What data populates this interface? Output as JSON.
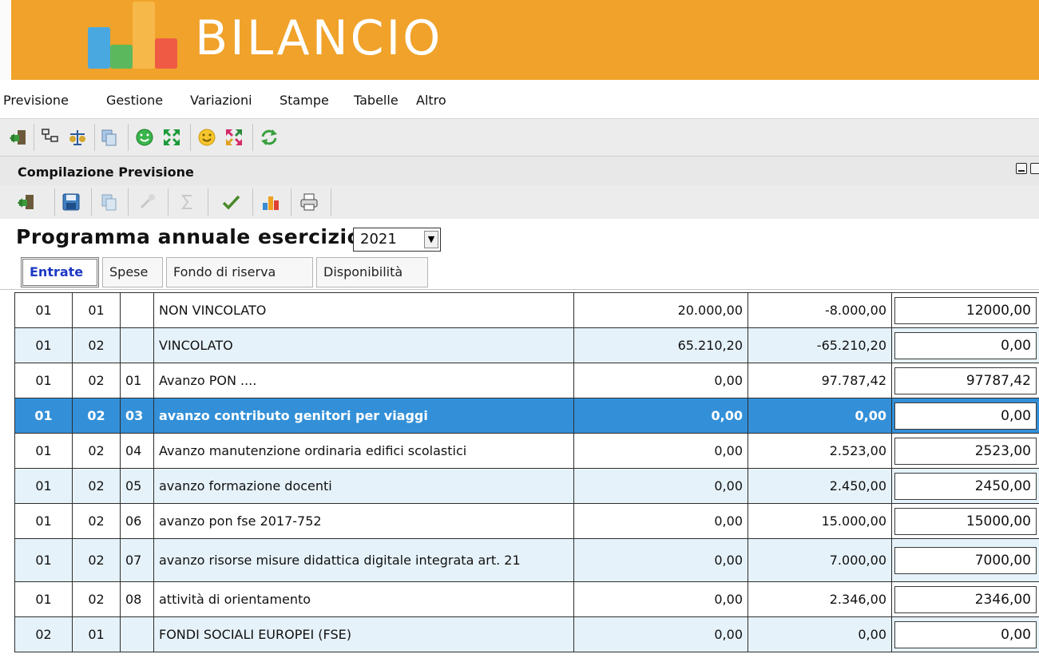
{
  "app": {
    "title": "BILANCIO"
  },
  "menu": [
    "Previsione",
    "Gestione",
    "Variazioni",
    "Stampe",
    "Tabelle",
    "Altro"
  ],
  "main_toolbar_icons": [
    "exit-icon",
    "tree-icon",
    "balance-icon",
    "copy-icon",
    "green-smiley-icon",
    "green-arrows-icon",
    "yellow-smiley-icon",
    "red-arrows-icon",
    "refresh-icon"
  ],
  "panel": {
    "title": "Compilazione Previsione"
  },
  "panel_toolbar_icons": [
    "exit-icon",
    "save-icon",
    "copy-icon",
    "wizard-icon",
    "sum-icon",
    "check-icon",
    "chart-icon",
    "print-icon"
  ],
  "heading": {
    "label": "Programma annuale esercizio",
    "year": "2021"
  },
  "tabs": [
    "Entrate",
    "Spese",
    "Fondo di riserva",
    "Disponibilità"
  ],
  "rows": [
    {
      "c1": "01",
      "c2": "01",
      "c3": "",
      "desc": "NON VINCOLATO",
      "v1": "20.000,00",
      "v2": "-8.000,00",
      "input": "12000,00"
    },
    {
      "c1": "01",
      "c2": "02",
      "c3": "",
      "desc": "VINCOLATO",
      "v1": "65.210,20",
      "v2": "-65.210,20",
      "input": "0,00"
    },
    {
      "c1": "01",
      "c2": "02",
      "c3": "01",
      "desc": "Avanzo PON ....",
      "v1": "0,00",
      "v2": "97.787,42",
      "input": "97787,42"
    },
    {
      "c1": "01",
      "c2": "02",
      "c3": "03",
      "desc": "avanzo contributo genitori per viaggi",
      "v1": "0,00",
      "v2": "0,00",
      "input": "0,00"
    },
    {
      "c1": "01",
      "c2": "02",
      "c3": "04",
      "desc": "Avanzo manutenzione ordinaria edifici scolastici",
      "v1": "0,00",
      "v2": "2.523,00",
      "input": "2523,00"
    },
    {
      "c1": "01",
      "c2": "02",
      "c3": "05",
      "desc": "avanzo formazione docenti",
      "v1": "0,00",
      "v2": "2.450,00",
      "input": "2450,00"
    },
    {
      "c1": "01",
      "c2": "02",
      "c3": "06",
      "desc": "avanzo pon fse 2017-752",
      "v1": "0,00",
      "v2": "15.000,00",
      "input": "15000,00"
    },
    {
      "c1": "01",
      "c2": "02",
      "c3": "07",
      "desc": "avanzo risorse misure didattica digitale integrata art. 21",
      "v1": "0,00",
      "v2": "7.000,00",
      "input": "7000,00"
    },
    {
      "c1": "01",
      "c2": "02",
      "c3": "08",
      "desc": "attività di orientamento",
      "v1": "0,00",
      "v2": "2.346,00",
      "input": "2346,00"
    },
    {
      "c1": "02",
      "c2": "01",
      "c3": "",
      "desc": "FONDI SOCIALI EUROPEI (FSE)",
      "v1": "0,00",
      "v2": "0,00",
      "input": "0,00"
    }
  ],
  "selected_row": 3,
  "colors": {
    "banner": "#f0a22a",
    "selected_row": "#3390d8",
    "alt_row": "#e6f2fa",
    "active_tab_text": "#1d39c4"
  }
}
